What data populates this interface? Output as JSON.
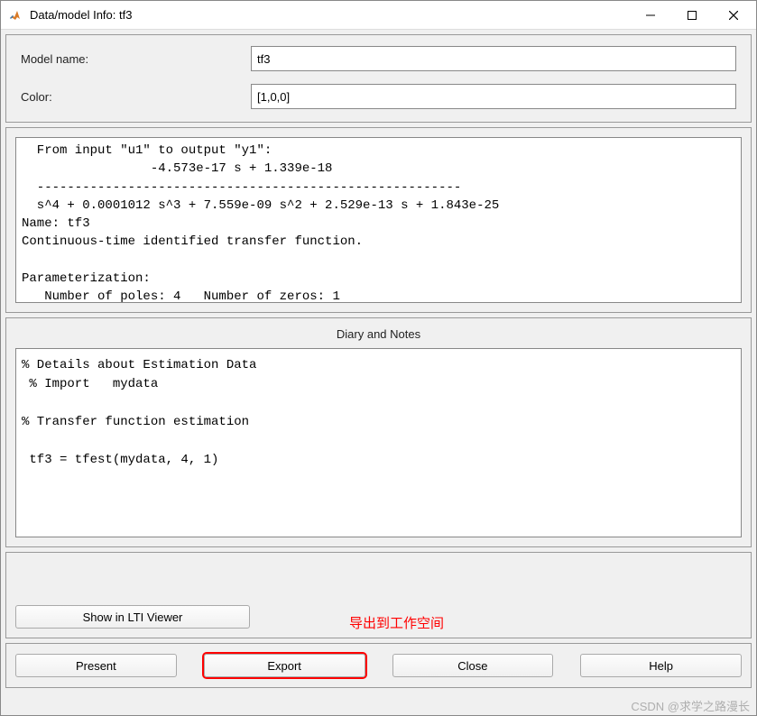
{
  "window": {
    "title": "Data/model Info: tf3"
  },
  "form": {
    "model_name_label": "Model name:",
    "model_name_value": "tf3",
    "color_label": "Color:",
    "color_value": "[1,0,0]"
  },
  "info_text": "  From input \"u1\" to output \"y1\":\n                 -4.573e-17 s + 1.339e-18\n  --------------------------------------------------------\n  s^4 + 0.0001012 s^3 + 7.559e-09 s^2 + 2.529e-13 s + 1.843e-25\nName: tf3\nContinuous-time identified transfer function.\n\nParameterization:\n   Number of poles: 4   Number of zeros: 1",
  "diary": {
    "title": "Diary and Notes",
    "text": "% Details about Estimation Data\n % Import   mydata\n\n% Transfer function estimation\n\n tf3 = tfest(mydata, 4, 1)"
  },
  "lti": {
    "button_label": "Show in LTI Viewer",
    "annotation": "导出到工作空间"
  },
  "actions": {
    "present": "Present",
    "export": "Export",
    "close": "Close",
    "help": "Help"
  },
  "watermark": "CSDN @求学之路漫长"
}
